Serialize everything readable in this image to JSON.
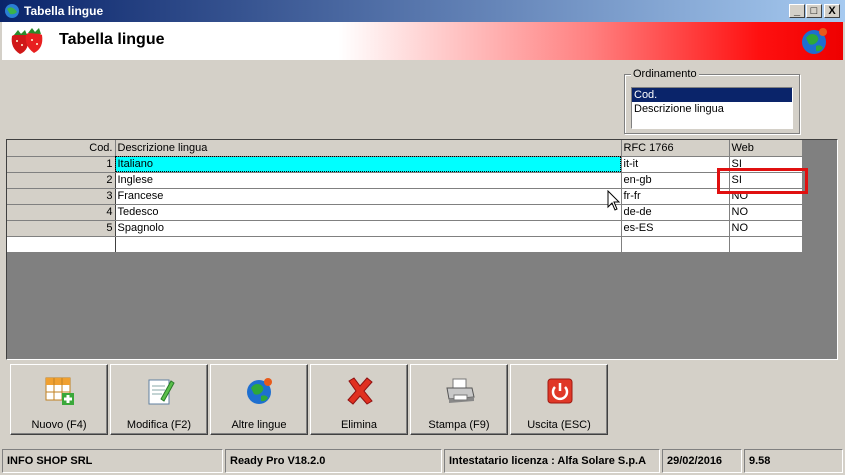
{
  "window": {
    "title": "Tabella lingue",
    "minimize": "_",
    "maximize": "□",
    "close": "X"
  },
  "header": {
    "title": "Tabella lingue"
  },
  "sort": {
    "legend": "Ordinamento",
    "options": [
      "Cod.",
      "Descrizione lingua"
    ],
    "selected": "Cod."
  },
  "table": {
    "columns": [
      "Cod.",
      "Descrizione lingua",
      "RFC 1766",
      "Web"
    ],
    "rows": [
      {
        "cod": "1",
        "desc": "Italiano",
        "rfc": "it-it",
        "web": "SI"
      },
      {
        "cod": "2",
        "desc": "Inglese",
        "rfc": "en-gb",
        "web": "SI"
      },
      {
        "cod": "3",
        "desc": "Francese",
        "rfc": "fr-fr",
        "web": "NO"
      },
      {
        "cod": "4",
        "desc": "Tedesco",
        "rfc": "de-de",
        "web": "NO"
      },
      {
        "cod": "5",
        "desc": "Spagnolo",
        "rfc": "es-ES",
        "web": "NO"
      }
    ]
  },
  "toolbar": {
    "new_label": "Nuovo (F4)",
    "edit_label": "Modifica (F2)",
    "other_lang_label": "Altre lingue",
    "delete_label": "Elimina",
    "print_label": "Stampa (F9)",
    "exit_label": "Uscita (ESC)"
  },
  "status": {
    "company": "INFO SHOP SRL",
    "version": "Ready Pro V18.2.0",
    "license": "Intestatario licenza : Alfa Solare S.p.A",
    "date": "29/02/2016",
    "build": "9.58"
  },
  "colors": {
    "selected_row": "#00ffff",
    "highlight": "#e01010",
    "title_gradient_start": "#0a246a"
  },
  "icons": [
    "app-icon",
    "strawberry-icon",
    "globe-icon",
    "new-grid-icon",
    "edit-icon",
    "globe-icon",
    "delete-x-icon",
    "printer-icon",
    "power-icon",
    "pointer-cursor"
  ]
}
